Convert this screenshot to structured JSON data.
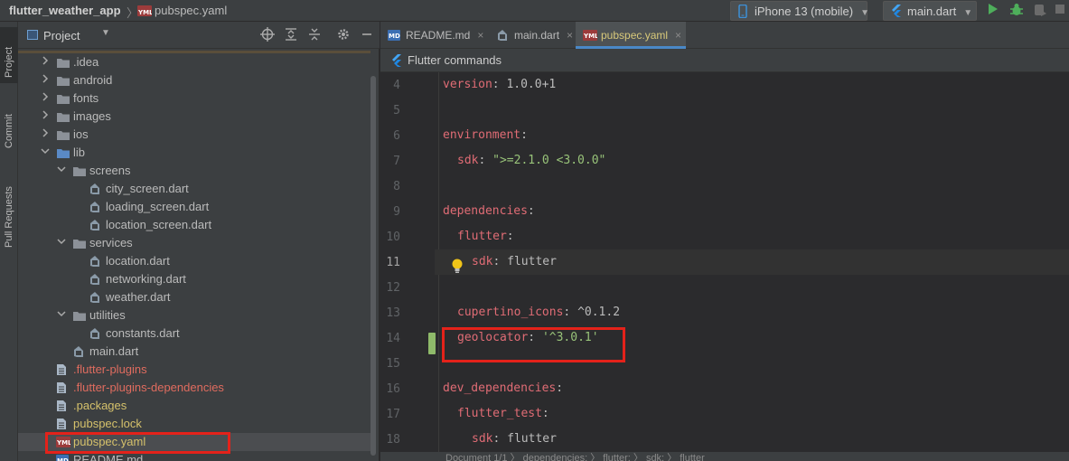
{
  "breadcrumb": {
    "project": "flutter_weather_app",
    "separator": "〉",
    "file": "pubspec.yaml"
  },
  "toolbar": {
    "device": "iPhone 13 (mobile)",
    "run_config": "main.dart",
    "accent": "#4eae5b"
  },
  "left_strip": {
    "project": "Project",
    "commit": "Commit",
    "pull_requests": "Pull Requests"
  },
  "project_panel": {
    "title": "Project",
    "partial_top": "...",
    "tree": [
      {
        "name": ".idea",
        "type": "folder",
        "depth": 1,
        "expanded": false
      },
      {
        "name": "android",
        "type": "folder",
        "depth": 1,
        "expanded": false
      },
      {
        "name": "fonts",
        "type": "folder",
        "depth": 1,
        "expanded": false
      },
      {
        "name": "images",
        "type": "folder",
        "depth": 1,
        "expanded": false
      },
      {
        "name": "ios",
        "type": "folder",
        "depth": 1,
        "expanded": false
      },
      {
        "name": "lib",
        "type": "folder",
        "depth": 1,
        "expanded": true
      },
      {
        "name": "screens",
        "type": "folder",
        "depth": 2,
        "expanded": true
      },
      {
        "name": "city_screen.dart",
        "type": "dart",
        "depth": 3
      },
      {
        "name": "loading_screen.dart",
        "type": "dart",
        "depth": 3
      },
      {
        "name": "location_screen.dart",
        "type": "dart",
        "depth": 3
      },
      {
        "name": "services",
        "type": "folder",
        "depth": 2,
        "expanded": true
      },
      {
        "name": "location.dart",
        "type": "dart",
        "depth": 3
      },
      {
        "name": "networking.dart",
        "type": "dart",
        "depth": 3
      },
      {
        "name": "weather.dart",
        "type": "dart",
        "depth": 3
      },
      {
        "name": "utilities",
        "type": "folder",
        "depth": 2,
        "expanded": true
      },
      {
        "name": "constants.dart",
        "type": "dart",
        "depth": 3
      },
      {
        "name": "main.dart",
        "type": "dart",
        "depth": 2
      },
      {
        "name": ".flutter-plugins",
        "type": "file",
        "depth": 1,
        "color": "red"
      },
      {
        "name": ".flutter-plugins-dependencies",
        "type": "file",
        "depth": 1,
        "color": "red"
      },
      {
        "name": ".packages",
        "type": "file",
        "depth": 1,
        "color": "yellow"
      },
      {
        "name": "pubspec.lock",
        "type": "file",
        "depth": 1,
        "color": "yellow"
      },
      {
        "name": "pubspec.yaml",
        "type": "yaml",
        "depth": 1,
        "color": "yellow",
        "selected": true
      },
      {
        "name": "README.md",
        "type": "md",
        "depth": 1
      }
    ]
  },
  "editor": {
    "tabs": [
      {
        "label": "README.md",
        "icon": "md-icon"
      },
      {
        "label": "main.dart",
        "icon": "dart-icon"
      },
      {
        "label": "pubspec.yaml",
        "icon": "yaml-icon",
        "active": true
      }
    ],
    "close_glyph": "×",
    "flutter_commands": "Flutter commands",
    "lines": [
      {
        "n": "4",
        "indent": 0,
        "key": "version",
        "sep": ": ",
        "value": "1.0.0+1",
        "vtype": "plain"
      },
      {
        "n": "5",
        "indent": 0
      },
      {
        "n": "6",
        "indent": 0,
        "key": "environment",
        "sep": ":"
      },
      {
        "n": "7",
        "indent": 1,
        "key": "sdk",
        "sep": ": ",
        "value": "\">=2.1.0 <3.0.0\"",
        "vtype": "string"
      },
      {
        "n": "8",
        "indent": 0
      },
      {
        "n": "9",
        "indent": 0,
        "key": "dependencies",
        "sep": ":"
      },
      {
        "n": "10",
        "indent": 1,
        "key": "flutter",
        "sep": ":"
      },
      {
        "n": "11",
        "indent": 2,
        "key": "sdk",
        "sep": ": ",
        "value": "flutter",
        "vtype": "plain",
        "current": true
      },
      {
        "n": "12",
        "indent": 0
      },
      {
        "n": "13",
        "indent": 1,
        "key": "cupertino_icons",
        "sep": ": ",
        "value": "^0.1.2",
        "vtype": "plain"
      },
      {
        "n": "14",
        "indent": 1,
        "key": "geolocator",
        "sep": ": ",
        "value": "'^3.0.1'",
        "vtype": "string"
      },
      {
        "n": "15",
        "indent": 0
      },
      {
        "n": "16",
        "indent": 0,
        "key": "dev_dependencies",
        "sep": ":"
      },
      {
        "n": "17",
        "indent": 1,
        "key": "flutter_test",
        "sep": ":"
      },
      {
        "n": "18",
        "indent": 2,
        "key": "sdk",
        "sep": ": ",
        "value": "flutter",
        "vtype": "plain"
      }
    ],
    "status_breadcrumb": "Document 1/1   〉  dependencies:  〉  flutter:  〉  sdk:  〉  flutter"
  },
  "highlight_color": "#e4221a"
}
